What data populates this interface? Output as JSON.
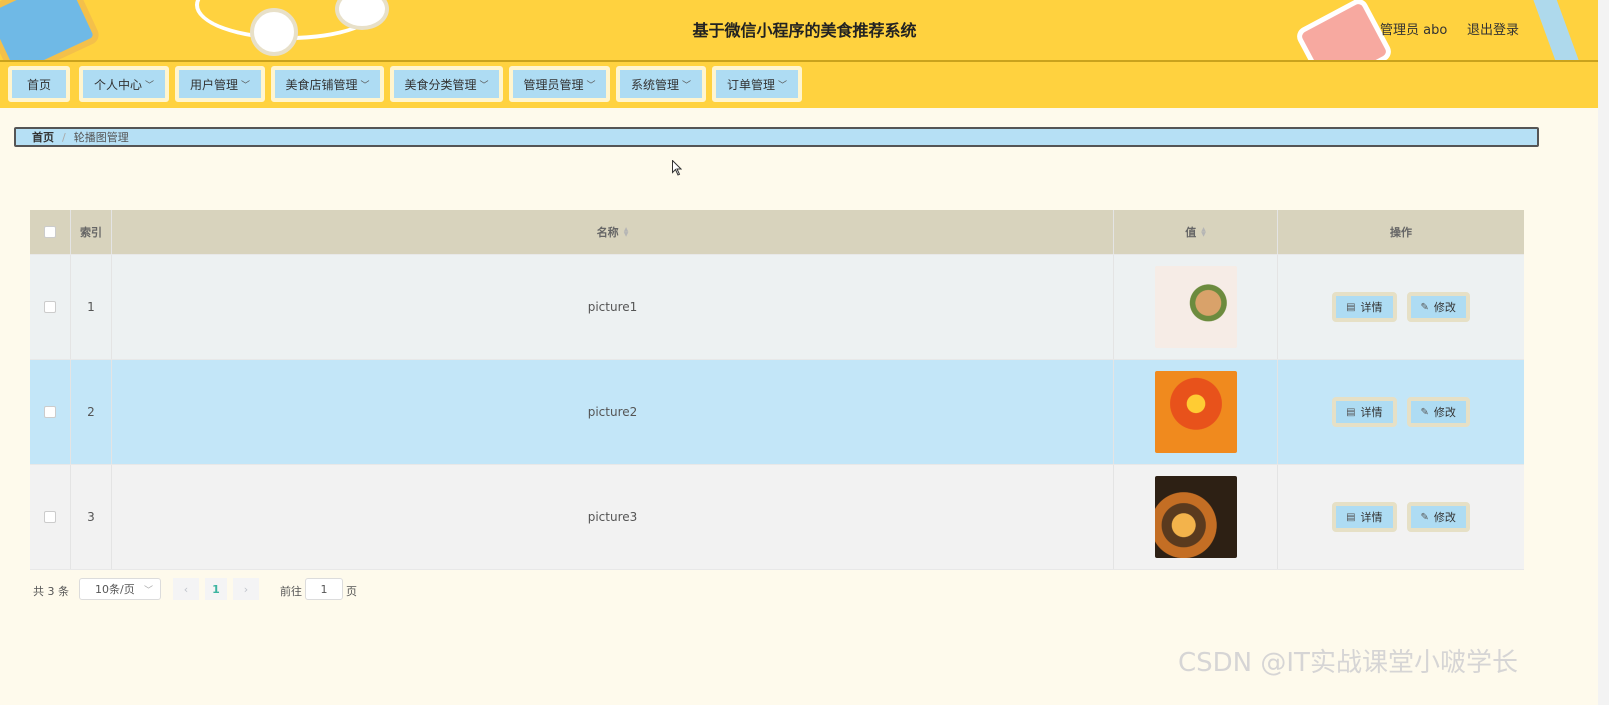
{
  "header": {
    "title": "基于微信小程序的美食推荐系统",
    "user": "管理员 abo",
    "logout": "退出登录"
  },
  "nav": [
    {
      "label": "首页"
    },
    {
      "label": "个人中心"
    },
    {
      "label": "用户管理"
    },
    {
      "label": "美食店铺管理"
    },
    {
      "label": "美食分类管理"
    },
    {
      "label": "管理员管理"
    },
    {
      "label": "系统管理"
    },
    {
      "label": "订单管理"
    }
  ],
  "breadcrumb": {
    "home": "首页",
    "separator": "/",
    "current": "轮播图管理"
  },
  "table": {
    "headers": {
      "index": "索引",
      "name": "名称",
      "value": "值",
      "actions": "操作"
    },
    "rows": [
      {
        "index": "1",
        "name": "picture1"
      },
      {
        "index": "2",
        "name": "picture2"
      },
      {
        "index": "3",
        "name": "picture3"
      }
    ],
    "detail_label": "详情",
    "edit_label": "修改"
  },
  "pagination": {
    "total": "共 3 条",
    "page_size": "10条/页",
    "current_page": "1",
    "goto_label": "前往",
    "goto_value": "1",
    "page_suffix": "页"
  },
  "watermark": "CSDN @IT实战课堂小啵学长",
  "colors": {
    "header_bg": "#ffd23f",
    "nav_button": "#aedcf3",
    "selected_row": "#c3e6f8",
    "page_bg": "#fefaec"
  }
}
